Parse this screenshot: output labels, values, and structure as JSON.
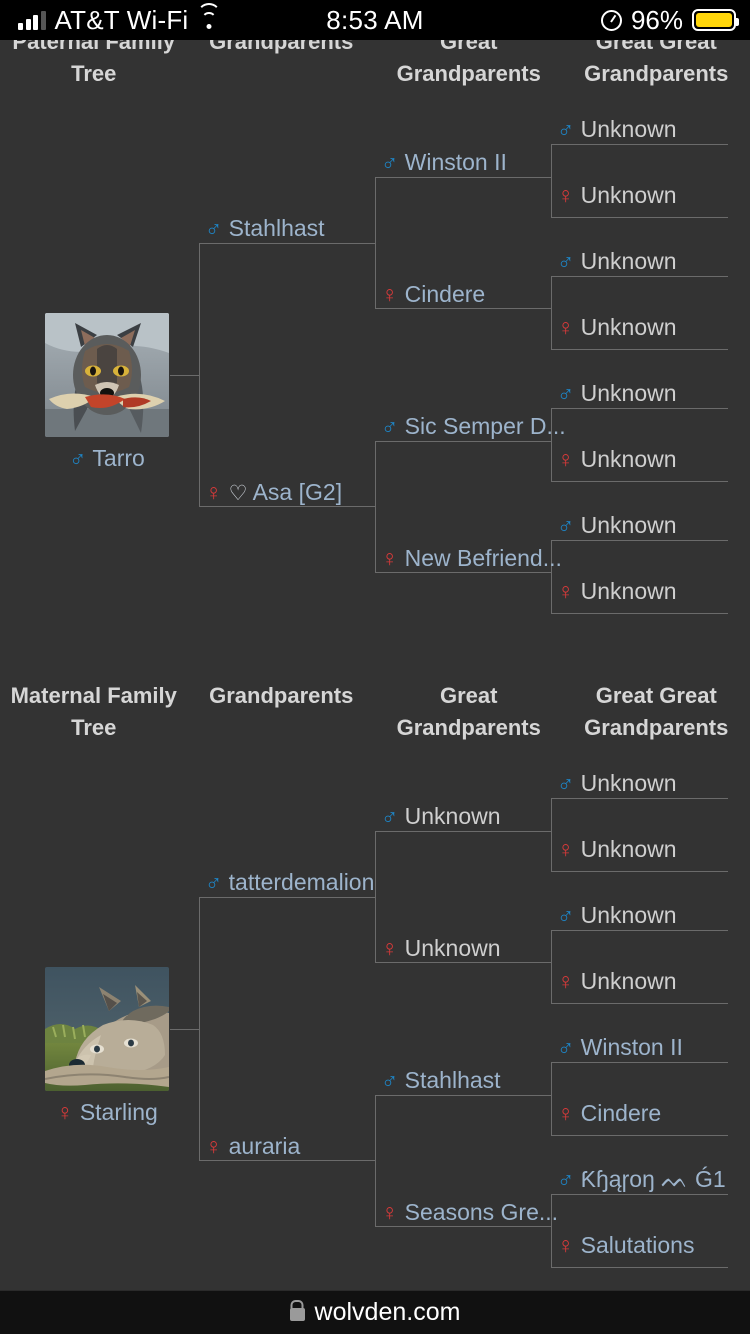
{
  "statusbar": {
    "carrier": "AT&T Wi-Fi",
    "time": "8:53 AM",
    "battery_pct": "96%",
    "signal_icon": "cellular-bars-icon",
    "wifi_icon": "wifi-icon",
    "orientation_lock_icon": "rotation-lock-icon",
    "battery_icon": "battery-icon"
  },
  "footer": {
    "url": "wolvden.com",
    "lock_icon": "lock-icon"
  },
  "paternal": {
    "headers": [
      "Paternal Family Tree",
      "Grandparents",
      "Great Grandparents",
      "Great Great Grandparents"
    ],
    "subject": {
      "name": "Tarro",
      "sex": "male",
      "portrait": "wolf-dark-with-bone-portrait"
    },
    "grandparents": [
      {
        "name": "Stahlhast",
        "sex": "male",
        "known": true,
        "heart": false
      },
      {
        "name": "Asa [G2]",
        "sex": "female",
        "known": true,
        "heart": true
      }
    ],
    "great_grandparents": [
      {
        "name": "Winston II",
        "sex": "male",
        "known": true
      },
      {
        "name": "Cindere",
        "sex": "female",
        "known": true
      },
      {
        "name": "Sic Semper D...",
        "sex": "male",
        "known": true
      },
      {
        "name": "New Befriend...",
        "sex": "female",
        "known": true
      }
    ],
    "great_great_grandparents": [
      {
        "name": "Unknown",
        "sex": "male",
        "known": false
      },
      {
        "name": "Unknown",
        "sex": "female",
        "known": false
      },
      {
        "name": "Unknown",
        "sex": "male",
        "known": false
      },
      {
        "name": "Unknown",
        "sex": "female",
        "known": false
      },
      {
        "name": "Unknown",
        "sex": "male",
        "known": false
      },
      {
        "name": "Unknown",
        "sex": "female",
        "known": false
      },
      {
        "name": "Unknown",
        "sex": "male",
        "known": false
      },
      {
        "name": "Unknown",
        "sex": "female",
        "known": false
      }
    ]
  },
  "maternal": {
    "headers": [
      "Maternal Family Tree",
      "Grandparents",
      "Great Grandparents",
      "Great Great Grandparents"
    ],
    "subject": {
      "name": "Starling",
      "sex": "female",
      "portrait": "wolf-cream-lying-on-grass-portrait"
    },
    "grandparents": [
      {
        "name": "tatterdemalion",
        "sex": "male",
        "known": true,
        "heart": false
      },
      {
        "name": "auraria",
        "sex": "female",
        "known": true,
        "heart": false
      }
    ],
    "great_grandparents": [
      {
        "name": "Unknown",
        "sex": "male",
        "known": false
      },
      {
        "name": "Unknown",
        "sex": "female",
        "known": false
      },
      {
        "name": "Stahlhast",
        "sex": "male",
        "known": true
      },
      {
        "name": "Seasons Gre...",
        "sex": "female",
        "known": true
      }
    ],
    "great_great_grandparents": [
      {
        "name": "Unknown",
        "sex": "male",
        "known": false
      },
      {
        "name": "Unknown",
        "sex": "female",
        "known": false
      },
      {
        "name": "Unknown",
        "sex": "male",
        "known": false
      },
      {
        "name": "Unknown",
        "sex": "female",
        "known": false
      },
      {
        "name": "Winston II",
        "sex": "male",
        "known": true
      },
      {
        "name": "Cindere",
        "sex": "female",
        "known": true
      },
      {
        "name": "Ƙɧąɼoŋ ᨓ Ǵ1",
        "sex": "male",
        "known": true
      },
      {
        "name": "Salutations",
        "sex": "female",
        "known": true
      }
    ]
  },
  "symbols": {
    "male": "♂",
    "female": "♀",
    "heart": "♡"
  },
  "colors": {
    "male": "#1e87c9",
    "female": "#d93a3a",
    "link": "#9db4cc",
    "unknown": "#cfcfcf",
    "bg": "#333333",
    "border": "#6b6b6b"
  }
}
